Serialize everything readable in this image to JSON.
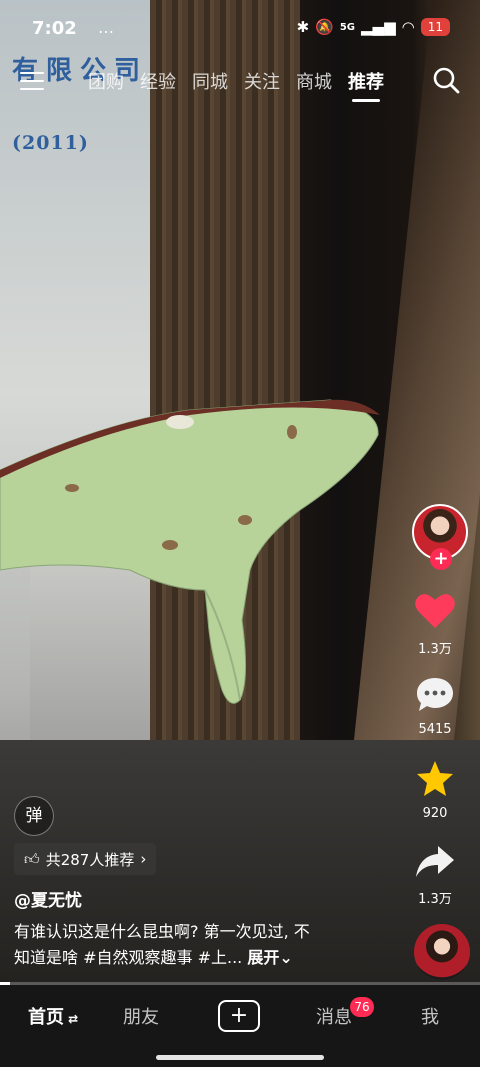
{
  "status_bar": {
    "time": "7:02",
    "extra": "…",
    "network": "5G",
    "battery": "11"
  },
  "wall_sign": {
    "line1": "有限公司",
    "line2": "(2011)"
  },
  "top_nav": {
    "tabs": [
      {
        "label": "团购"
      },
      {
        "label": "经验"
      },
      {
        "label": "同城"
      },
      {
        "label": "关注"
      },
      {
        "label": "商城"
      },
      {
        "label": "推荐"
      }
    ],
    "active_tab": "推荐"
  },
  "actions": {
    "likes": "1.3万",
    "comments": "5415",
    "favorites": "920",
    "shares": "1.3万",
    "follow_symbol": "+"
  },
  "caption": {
    "danmu_label": "弹",
    "recommend": "共287人推荐",
    "author": "@夏无忧",
    "text_line1": "有谁认识这是什么昆虫啊? 第一次见过, 不",
    "text_line2": "知道是啥",
    "hashtags": "#自然观察趣事 #上...",
    "more": "展开"
  },
  "progress": {
    "fraction": 0.02
  },
  "bottom_nav": {
    "home": "首页",
    "friends": "朋友",
    "add": "+",
    "messages": "消息",
    "messages_badge": "76",
    "me": "我"
  },
  "colors": {
    "accent": "#fe2c55",
    "like": "#ff3b5c",
    "favorite": "#ffc800"
  }
}
